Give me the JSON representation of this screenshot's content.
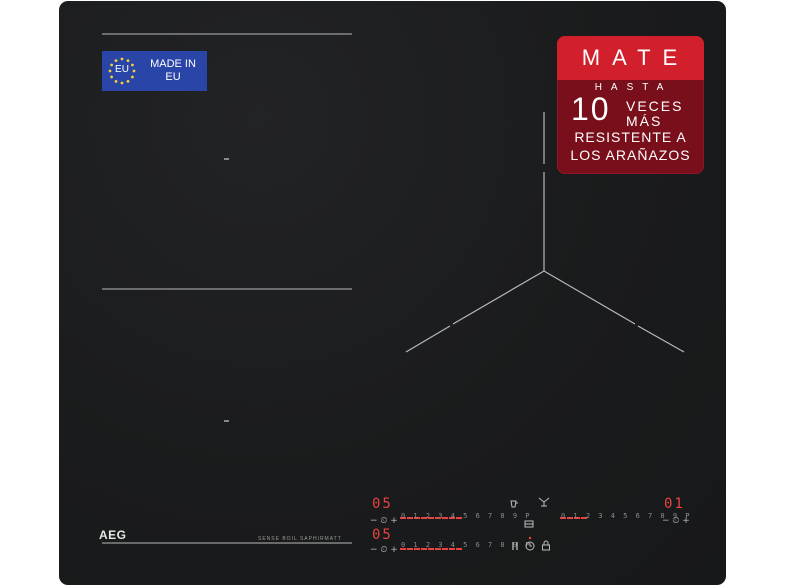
{
  "colors": {
    "glass": "#1b1c1d",
    "zone_lines": "#b9b9b9",
    "display_red": "#e8433e",
    "eu_blue": "#2a45a8",
    "mate_dark_red": "#7a0f1c",
    "mate_bright_red": "#d21f2c"
  },
  "eu_badge": {
    "flag_code": "EU",
    "line1": "MADE IN",
    "line2": "EU"
  },
  "mate_badge": {
    "title": "MATE",
    "hasta": "HASTA",
    "number": "10",
    "veces": "VECES",
    "mas": "MÁS",
    "line1": "RESISTENTE A",
    "line2": "LOS ARAÑAZOS"
  },
  "brand": "AEG",
  "features": "SENSE BOIL SAPHIRMATT",
  "controls": {
    "left_top_display": "05",
    "left_bottom_display": "05",
    "right_display": "01",
    "scale": "0 1 2 3 4 5 6 7 8 9 P",
    "minus_timer_plus": "− ⏲ +"
  },
  "icons": [
    "pan-icon",
    "hob2hood-fan-icon",
    "bridge-icon",
    "pause-icon",
    "timer-icon",
    "lock-icon"
  ]
}
